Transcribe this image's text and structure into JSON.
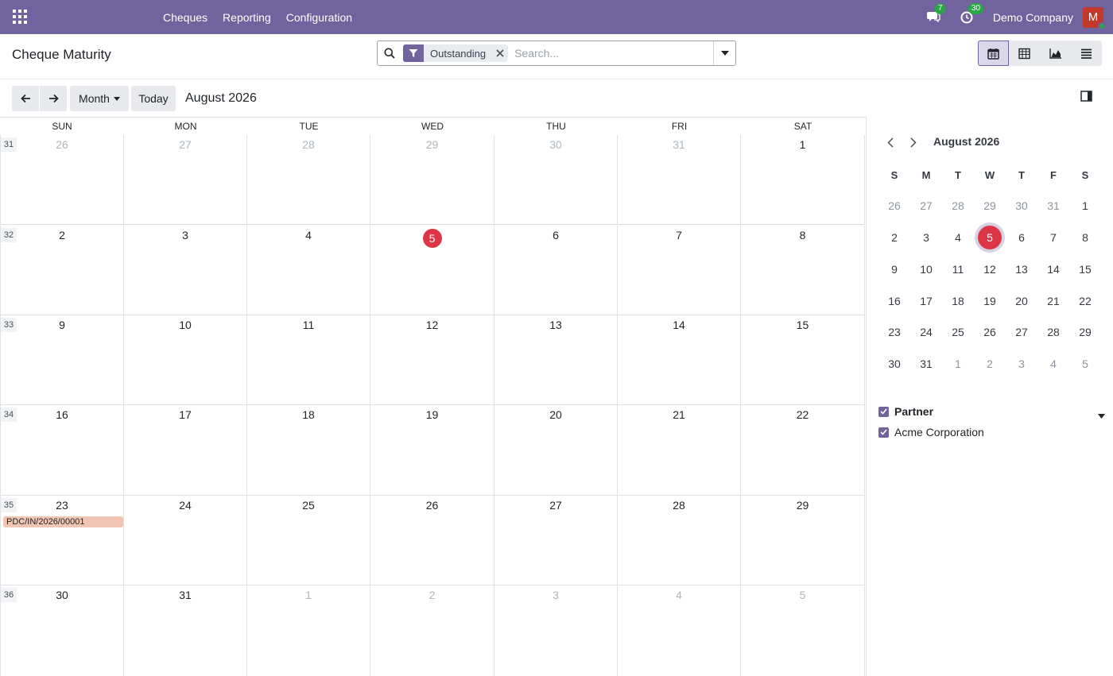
{
  "navbar": {
    "menu": [
      "Cheques",
      "Reporting",
      "Configuration"
    ],
    "messages_count": "7",
    "activities_count": "30",
    "company": "Demo Company",
    "avatar_initial": "M",
    "color": "#71639e"
  },
  "control": {
    "title": "Cheque Maturity",
    "facet_label": "Outstanding",
    "search_placeholder": "Search..."
  },
  "toolbar": {
    "scale_label": "Month",
    "today_label": "Today",
    "range_title": "August 2026"
  },
  "calendar": {
    "day_headers": [
      "SUN",
      "MON",
      "TUE",
      "WED",
      "THU",
      "FRI",
      "SAT"
    ],
    "weeks": [
      {
        "week": "31",
        "days": [
          "26",
          "27",
          "28",
          "29",
          "30",
          "31",
          "1"
        ],
        "other": [
          true,
          true,
          true,
          true,
          true,
          true,
          false
        ]
      },
      {
        "week": "32",
        "days": [
          "2",
          "3",
          "4",
          "5",
          "6",
          "7",
          "8"
        ],
        "other": [
          false,
          false,
          false,
          false,
          false,
          false,
          false
        ]
      },
      {
        "week": "33",
        "days": [
          "9",
          "10",
          "11",
          "12",
          "13",
          "14",
          "15"
        ],
        "other": [
          false,
          false,
          false,
          false,
          false,
          false,
          false
        ]
      },
      {
        "week": "34",
        "days": [
          "16",
          "17",
          "18",
          "19",
          "20",
          "21",
          "22"
        ],
        "other": [
          false,
          false,
          false,
          false,
          false,
          false,
          false
        ]
      },
      {
        "week": "35",
        "days": [
          "23",
          "24",
          "25",
          "26",
          "27",
          "28",
          "29"
        ],
        "other": [
          false,
          false,
          false,
          false,
          false,
          false,
          false
        ]
      },
      {
        "week": "36",
        "days": [
          "30",
          "31",
          "1",
          "2",
          "3",
          "4",
          "5"
        ],
        "other": [
          false,
          false,
          true,
          true,
          true,
          true,
          true
        ]
      }
    ],
    "today": "5",
    "events": [
      {
        "label": "PDC/IN/2026/00001",
        "date": "23",
        "color": "#f0c5b4"
      }
    ],
    "today_color": "#dc3545"
  },
  "mini_calendar": {
    "title": "August 2026",
    "day_headers": [
      "S",
      "M",
      "T",
      "W",
      "T",
      "F",
      "S"
    ],
    "weeks": [
      [
        "26",
        "27",
        "28",
        "29",
        "30",
        "31",
        "1"
      ],
      [
        "2",
        "3",
        "4",
        "5",
        "6",
        "7",
        "8"
      ],
      [
        "9",
        "10",
        "11",
        "12",
        "13",
        "14",
        "15"
      ],
      [
        "16",
        "17",
        "18",
        "19",
        "20",
        "21",
        "22"
      ],
      [
        "23",
        "24",
        "25",
        "26",
        "27",
        "28",
        "29"
      ],
      [
        "30",
        "31",
        "1",
        "2",
        "3",
        "4",
        "5"
      ]
    ],
    "today": "5"
  },
  "filters": {
    "title": "Partner",
    "items": [
      "Acme Corporation"
    ]
  }
}
